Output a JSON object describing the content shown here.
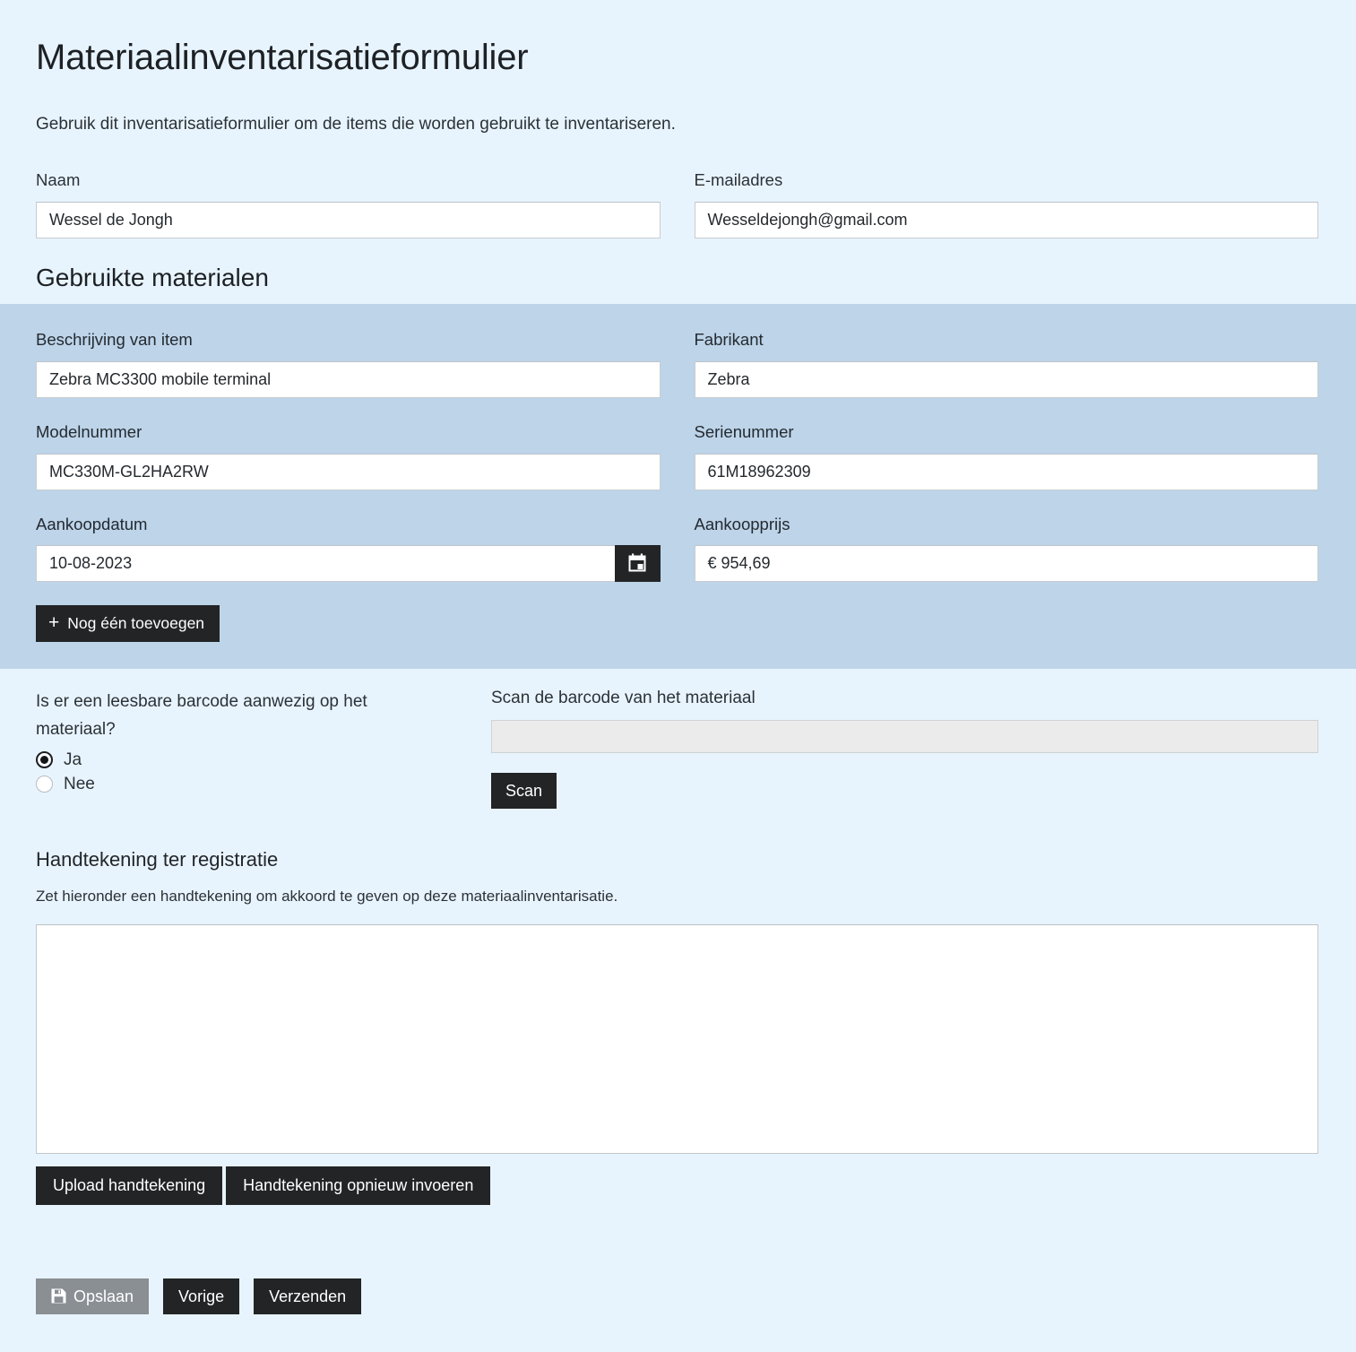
{
  "form": {
    "title": "Materiaalinventarisatieformulier",
    "intro": "Gebruik dit inventarisatieformulier om de items die worden gebruikt te inventariseren."
  },
  "contact": {
    "name_label": "Naam",
    "name_value": "Wessel de Jongh",
    "email_label": "E-mailadres",
    "email_value": "Wesseldejongh@gmail.com"
  },
  "materials": {
    "section_title": "Gebruikte materialen",
    "description_label": "Beschrijving van item",
    "description_value": "Zebra MC3300 mobile terminal",
    "manufacturer_label": "Fabrikant",
    "manufacturer_value": "Zebra",
    "model_label": "Modelnummer",
    "model_value": "MC330M-GL2HA2RW",
    "serial_label": "Serienummer",
    "serial_value": "61M18962309",
    "purchase_date_label": "Aankoopdatum",
    "purchase_date_value": "10-08-2023",
    "purchase_price_label": "Aankoopprijs",
    "purchase_price_value": "€ 954,69",
    "add_another_label": "Nog één toevoegen",
    "add_another_plus": "+",
    "calendar_icon": "calendar-icon"
  },
  "barcode": {
    "question_label": "Is er een leesbare barcode aanwezig op het materiaal?",
    "option_yes": "Ja",
    "option_no": "Nee",
    "selected": "Ja",
    "scan_label": "Scan de barcode van het materiaal",
    "scan_value": "",
    "scan_placeholder": "",
    "scan_button_label": "Scan"
  },
  "signature": {
    "heading": "Handtekening ter registratie",
    "subtext": "Zet hieronder een handtekening om akkoord te geven op deze materiaalinventarisatie.",
    "upload_label": "Upload handtekening",
    "redo_label": "Handtekening opnieuw invoeren"
  },
  "footer": {
    "save_label": "Opslaan",
    "save_icon": "save-floppy-icon",
    "previous_label": "Vorige",
    "submit_label": "Verzenden"
  },
  "colors": {
    "page_background": "#e8f4fd",
    "panel_background": "#bdd4e9",
    "button_dark": "#222426",
    "button_disabled": "#8a8f94",
    "input_disabled": "#ebebeb"
  }
}
